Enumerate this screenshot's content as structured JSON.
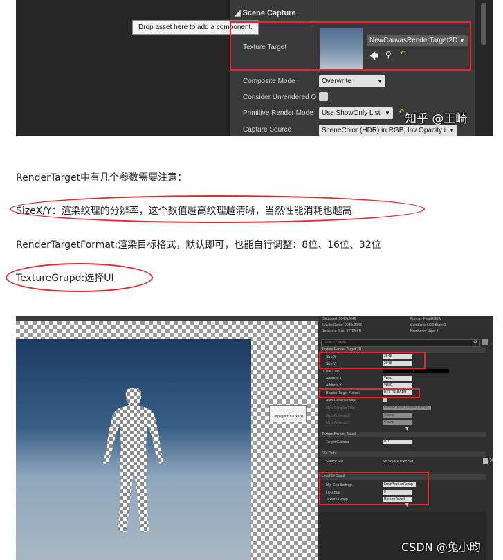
{
  "top_screenshot": {
    "section_title": "Scene Capture",
    "tooltip": "Drop asset here to add a component.",
    "texture_target_label": "Texture Target",
    "texture_target_value": "NewCanvasRenderTarget2D",
    "composite_mode_label": "Composite Mode",
    "composite_mode_value": "Overwrite",
    "consider_unrendered_label": "Consider Unrendered O",
    "primitive_render_mode_label": "Primitive Render Mode",
    "primitive_render_mode_value": "Use ShowOnly List",
    "capture_source_label": "Capture Source",
    "capture_source_value": "SceneColor (HDR) in RGB, Inv Opacity i",
    "watermark": "知乎 @王崎"
  },
  "paragraphs": {
    "p1": "RenderTarget中有几个参数需要注意：",
    "p2": "SizeX/Y：渲染纹理的分辨率，这个数值越高纹理越清晰，当然性能消耗也越高",
    "p3": "RenderTargetFormat:渲染目标格式，默认即可，也能自行调整：8位、16位、32位",
    "p4": "TextureGrupd:选择UI"
  },
  "bottom_screenshot": {
    "info": {
      "displayed": "Displayed: 2048x2048",
      "max_ingame": "Max In-Game: 2048x2048",
      "resource_size": "Resource Size: 32768 KB",
      "format": "Format: FloatRGBA",
      "lod_bias": "Combined LOD Bias: 0",
      "num_mips": "Number of Mips: 1"
    },
    "viewport_label": "Viewport",
    "displayed_badge": "Displayed: 870x870",
    "search_placeholder": "Search Details",
    "sections": {
      "texture_render_target_2d": "Texture Render Target 2D",
      "texture_render_target": "Texture Render Target",
      "file_path": "File Path",
      "level_of_detail": "Level Of Detail"
    },
    "props": {
      "size_x": {
        "label": "Size X",
        "value": "2048"
      },
      "size_y": {
        "label": "Size Y",
        "value": "2048"
      },
      "clear_color": {
        "label": "Clear Color"
      },
      "address_x": {
        "label": "Address X",
        "value": "Wrap"
      },
      "address_y": {
        "label": "Address Y",
        "value": "Wrap"
      },
      "render_target_format": {
        "label": "Render Target Format",
        "value": "RTF RGBA16f"
      },
      "auto_generate_mips": {
        "label": "Auto Generate Mips"
      },
      "mips_sampler_filter": {
        "label": "Mips Sampler Filter",
        "value": "Default (from Texture Group)"
      },
      "mips_address_u": {
        "label": "Mips Address U",
        "value": "Clamp"
      },
      "mips_address_v": {
        "label": "Mips Address V",
        "value": "Clamp"
      },
      "target_gamma": {
        "label": "Target Gamma",
        "value": "0.0"
      },
      "source_file": {
        "label": "Source File",
        "value": "No Source Path Set"
      },
      "mip_gen_settings": {
        "label": "Mip Gen Settings",
        "value": "FromTextureGroup"
      },
      "lod_bias": {
        "label": "LOD Bias",
        "value": "0"
      },
      "texture_group": {
        "label": "Texture Group",
        "value": "RenderTarget"
      }
    },
    "watermark": "CSDN @兔小昀"
  },
  "colors": {
    "annotation_red": "#e8262c"
  }
}
